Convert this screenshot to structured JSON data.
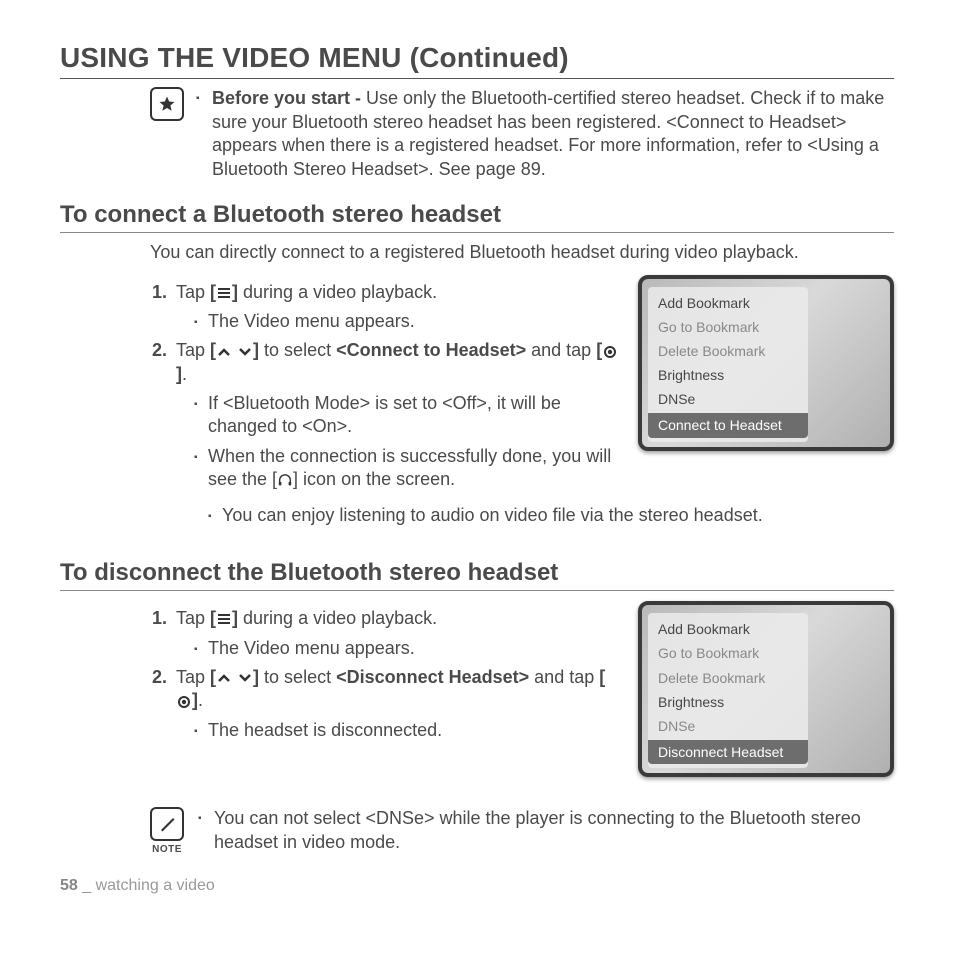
{
  "title": "USING THE VIDEO MENU (Continued)",
  "starNote": {
    "lead": "Before you start -",
    "rest": " Use only the Bluetooth-certified stereo headset. Check if to make sure your Bluetooth stereo headset has been registered. <Connect to Headset> appears when there is a registered headset. For more information, refer to <Using a Bluetooth Stereo Headset>. See page 89."
  },
  "sectionA": {
    "heading": "To connect a Bluetooth stereo headset",
    "intro": "You can directly connect to a registered Bluetooth headset during video playback.",
    "step1a": "Tap ",
    "step1b": " during a video playback.",
    "step1sub": "The Video menu appears.",
    "step2a": "Tap ",
    "step2b": " to select ",
    "step2target": "<Connect to Headset>",
    "step2c": " and tap ",
    "step2d": ".",
    "sub1": "If <Bluetooth Mode> is set to <Off>, it will be changed to <On>.",
    "sub2a": "When the connection is successfully done, you will see the [",
    "sub2b": "] icon on the screen.",
    "sub3": "You can enjoy listening to audio on video file via the stereo headset.",
    "menu": {
      "items": [
        "Add Bookmark",
        "Go to Bookmark",
        "Delete Bookmark",
        "Brightness",
        "DNSe"
      ],
      "highlight": "Connect to Headset",
      "active": [
        0,
        3,
        4
      ]
    }
  },
  "sectionB": {
    "heading": "To disconnect the Bluetooth stereo headset",
    "step1a": "Tap ",
    "step1b": " during a video playback.",
    "step1sub": "The Video menu appears.",
    "step2a": "Tap ",
    "step2b": " to select ",
    "step2target": "<Disconnect Headset>",
    "step2c": " and tap ",
    "step2d": ".",
    "sub1": "The headset is disconnected.",
    "menu": {
      "items": [
        "Add Bookmark",
        "Go to Bookmark",
        "Delete Bookmark",
        "Brightness",
        "DNSe"
      ],
      "highlight": "Disconnect Headset",
      "active": [
        0,
        3
      ]
    }
  },
  "bottomNote": {
    "label": "NOTE",
    "text": "You can not select <DNSe> while the player is connecting to the Bluetooth stereo headset in video mode."
  },
  "footer": {
    "page": "58",
    "sep": " _ ",
    "chapter": "watching a video"
  },
  "icons": {
    "menuBtn": "[≡]",
    "selectBtn": "[◉]"
  }
}
